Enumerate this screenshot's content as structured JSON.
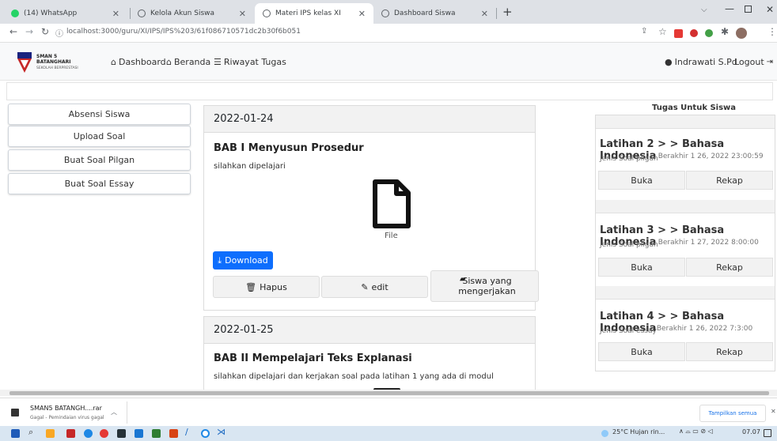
{
  "browser": {
    "tabs": [
      {
        "label": "(14) WhatsApp",
        "icon": "whatsapp-icon",
        "icon_color": "#25d366"
      },
      {
        "label": "Kelola Akun Siswa",
        "icon": "globe-icon",
        "icon_color": "#5f6368"
      },
      {
        "label": "Materi IPS kelas XI",
        "icon": "globe-icon",
        "icon_color": "#5f6368"
      },
      {
        "label": "Dashboard Siswa",
        "icon": "globe-icon",
        "icon_color": "#5f6368"
      }
    ],
    "url": "localhost:3000/guru/XI/IPS/IPS%203/61f086710571dc2b30f6b051"
  },
  "header": {
    "school_name": "SMAN 5 BATANGHARI",
    "school_tagline": "SEKOLAH BERPRESTASI",
    "nav": [
      {
        "label": "Dashboard",
        "icon": "home-icon"
      },
      {
        "label": "Beranda",
        "icon": "home-icon"
      },
      {
        "label": "Riwayat Tugas",
        "icon": "list-icon"
      }
    ],
    "user": "Indrawati S.Pd",
    "logout": "Logout"
  },
  "sidebar": {
    "items": [
      {
        "label": "Absensi Siswa"
      },
      {
        "label": "Upload Soal"
      },
      {
        "label": "Buat Soal Pilgan"
      },
      {
        "label": "Buat Soal Essay"
      }
    ]
  },
  "materials": [
    {
      "date": "2022-01-24",
      "title": "BAB I Menyusun Prosedur",
      "description": "silahkan dipelajari",
      "file_label": "File",
      "download_label": "Download",
      "delete_label": "Hapus",
      "edit_label": "edit",
      "students_label": "Siswa yang mengerjakan"
    },
    {
      "date": "2022-01-25",
      "title": "BAB II Mempelajari Teks Explanasi",
      "description": "silahkan dipelajari dan kerjakan soal pada latihan 1 yang ada di modul"
    }
  ],
  "tasks": {
    "heading": "Tugas Untuk Siswa",
    "items": [
      {
        "title": "Latihan 2 > > Bahasa Indonesia",
        "type": "Jenis Soal pilgan",
        "deadline": "Berakhir 1 26, 2022 23:00:59",
        "open": "Buka",
        "recap": "Rekap"
      },
      {
        "title": "Latihan 3 > > Bahasa Indonesia",
        "type": "Jenis Soal pilgan",
        "deadline": "Berakhir 1 27, 2022 8:00:00",
        "open": "Buka",
        "recap": "Rekap"
      },
      {
        "title": "Latihan 4 > > Bahasa Indonesia",
        "type": "Jenis Soal essay",
        "deadline": "Berakhir 1 26, 2022 7:3:00",
        "open": "Buka",
        "recap": "Rekap"
      }
    ]
  },
  "download_shelf": {
    "file": "SMAN5 BATANGH....rar",
    "status": "Gagal - Pemindaian virus gagal",
    "show_all": "Tampilkan semua"
  },
  "taskbar": {
    "weather": "25°C  Hujan rin...",
    "time": "07.07"
  },
  "colors": {
    "primary": "#0d6efd",
    "navbar_bg": "#f8f9fa",
    "taskbar_bg": "#d9e6f2"
  }
}
